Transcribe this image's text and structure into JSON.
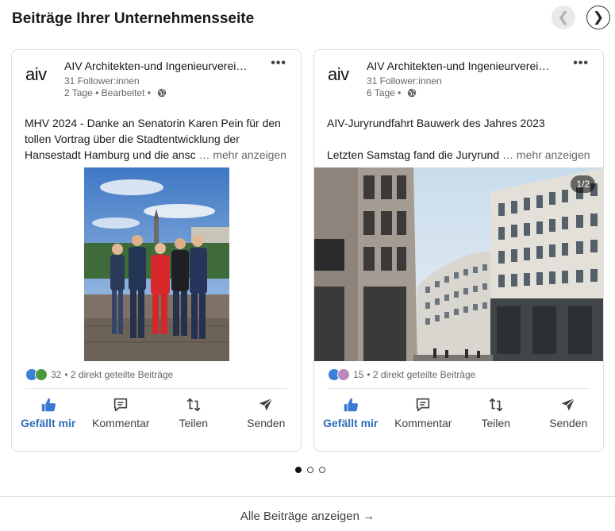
{
  "header": {
    "title": "Beiträge Ihrer Unternehmensseite",
    "prev_icon": "chevron-left-icon",
    "next_icon": "chevron-right-icon"
  },
  "posts": [
    {
      "logo_text": "aiv",
      "company": "AIV Architekten-und Ingenieurverei…",
      "followers": "31 Follower:innen",
      "meta": "2 Tage • Bearbeitet •",
      "text_line1": "MHV 2024 - Danke an Senatorin Karen Pein für den",
      "text_line2": "tollen Vortrag über die Stadtentwicklung der",
      "text_line3": "Hansestadt Hamburg und die ansc",
      "more": "… mehr anzeigen",
      "reactions_count": "32",
      "shares": "• 2 direkt geteilte Beiträge",
      "actions": [
        "Gefällt mir",
        "Kommentar",
        "Teilen",
        "Senden"
      ]
    },
    {
      "logo_text": "aiv",
      "company": "AIV Architekten-und Ingenieurverei…",
      "followers": "31 Follower:innen",
      "meta": "6 Tage •",
      "text_line1": "AIV-Juryrundfahrt Bauwerk des Jahres 2023",
      "text_line2": "",
      "text_line3": "Letzten Samstag fand die Juryrund",
      "more": "… mehr anzeigen",
      "image_counter": "1/2",
      "reactions_count": "15",
      "shares": "• 2 direkt geteilte Beiträge",
      "actions": [
        "Gefällt mir",
        "Kommentar",
        "Teilen",
        "Senden"
      ]
    }
  ],
  "footer": {
    "label": "Alle Beiträge anzeigen →"
  },
  "carousel": {
    "total": 3,
    "active": 1
  },
  "colors": {
    "accent": "#2f6fb7",
    "muted": "#666666",
    "border": "#e0dfdc"
  }
}
